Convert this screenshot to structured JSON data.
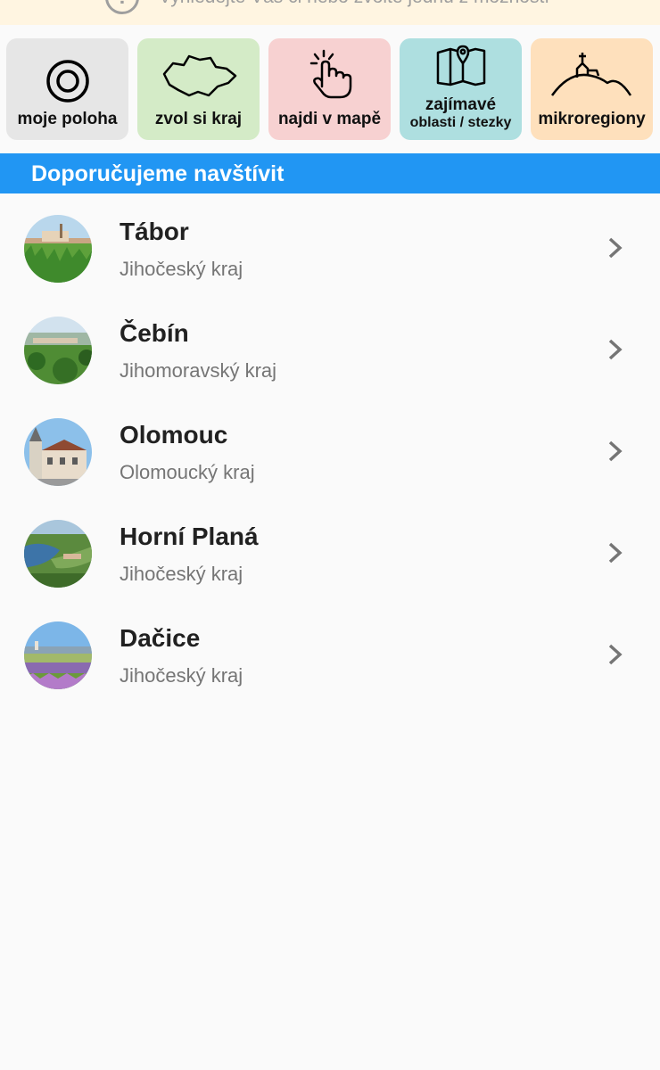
{
  "banner": {
    "text": "Vyhledejte Vás či nebo zvolte jednu z možností",
    "icon": "alert-circle-icon"
  },
  "tiles": [
    {
      "label": "moje poloha",
      "icon": "target-icon",
      "color": "#e6e6e6"
    },
    {
      "label": "zvol si kraj",
      "icon": "czech-map-icon",
      "color": "#d4ebc7"
    },
    {
      "label": "najdi v mapě",
      "icon": "pointing-hand-icon",
      "color": "#f7d1d1"
    },
    {
      "label_line1": "zajímavé",
      "label_line2": "oblasti / stezky",
      "icon": "folded-map-pin-icon",
      "color": "#aedfe0"
    },
    {
      "label": "mikroregiony",
      "icon": "hill-chapel-icon",
      "color": "#fee0bc"
    }
  ],
  "section": {
    "title": "Doporučujeme navštívit",
    "color": "#2196f3"
  },
  "places": [
    {
      "name": "Tábor",
      "region": "Jihočeský kraj"
    },
    {
      "name": "Čebín",
      "region": "Jihomoravský kraj"
    },
    {
      "name": "Olomouc",
      "region": "Olomoucký kraj"
    },
    {
      "name": "Horní Planá",
      "region": "Jihočeský kraj"
    },
    {
      "name": "Dačice",
      "region": "Jihočeský kraj"
    }
  ]
}
